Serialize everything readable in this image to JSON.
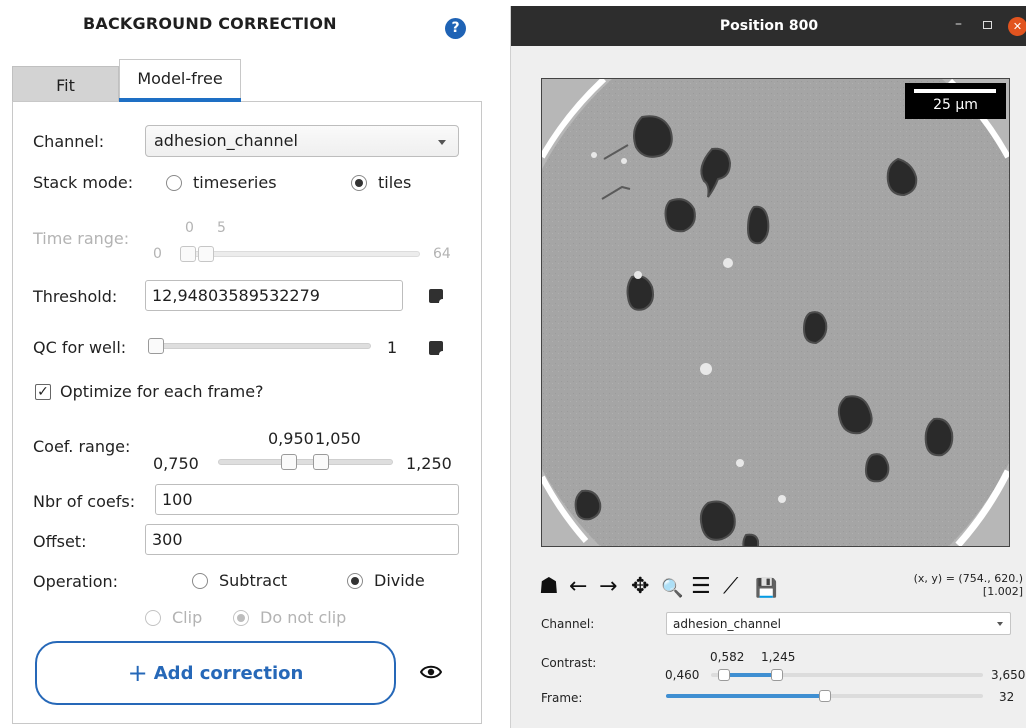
{
  "panel": {
    "title": "BACKGROUND CORRECTION",
    "help_icon": "?",
    "tabs": [
      {
        "label": "Fit",
        "active": false
      },
      {
        "label": "Model-free",
        "active": true
      }
    ]
  },
  "form": {
    "channel": {
      "label": "Channel:",
      "value": "adhesion_channel"
    },
    "stack_mode": {
      "label": "Stack mode:",
      "options": [
        {
          "label": "timeseries",
          "checked": false
        },
        {
          "label": "tiles",
          "checked": true
        }
      ]
    },
    "time_range": {
      "label": "Time range:",
      "min": "0",
      "max": "64",
      "low": "0",
      "high": "5",
      "enabled": false
    },
    "threshold": {
      "label": "Threshold:",
      "value": "12,94803589532279"
    },
    "qc_for_well": {
      "label": "QC for well:",
      "value": "1"
    },
    "optimize": {
      "label": "Optimize for each frame?",
      "checked": true,
      "mark": "✓"
    },
    "coef_range": {
      "label": "Coef. range:",
      "min": "0,750",
      "max": "1,250",
      "low": "0,950",
      "high": "1,050"
    },
    "nbr_of_coefs": {
      "label": "Nbr of coefs:",
      "value": "100"
    },
    "offset": {
      "label": "Offset:",
      "value": "300"
    },
    "operation": {
      "label": "Operation:",
      "options": [
        {
          "label": "Subtract",
          "checked": false
        },
        {
          "label": "Divide",
          "checked": true
        }
      ]
    },
    "clip": {
      "options": [
        {
          "label": "Clip",
          "checked": false
        },
        {
          "label": "Do not clip",
          "checked": true
        }
      ],
      "enabled": false
    },
    "add_button": {
      "icon": "+",
      "label": "Add correction"
    }
  },
  "viewer": {
    "title": "Position 800",
    "window_controls": {
      "minimize": "–",
      "close": "✕"
    },
    "scalebar": "25 µm",
    "toolbar_icons": [
      "home-icon",
      "back-arrow-icon",
      "forward-arrow-icon",
      "pan-icon",
      "zoom-icon",
      "configure-icon",
      "edit-axis-icon",
      "save-icon"
    ],
    "toolbar_glyphs": [
      "☗",
      "←",
      "→",
      "✥",
      "🔍",
      "☰",
      "⟋",
      "💾"
    ],
    "coords_line1": "(x, y) = (754., 620.)",
    "coords_line2": "[1.002]",
    "channel": {
      "label": "Channel:",
      "value": "adhesion_channel"
    },
    "contrast": {
      "label": "Contrast:",
      "min": "0,460",
      "max": "3,650",
      "low": "0,582",
      "high": "1,245"
    },
    "frame": {
      "label": "Frame:",
      "max": "32"
    }
  },
  "colors": {
    "accent": "#1e6fc4",
    "button_border": "#2668b8",
    "titlebar": "#2d2d2d",
    "close": "#e2541f",
    "slider_fill": "#3f8fd2"
  }
}
